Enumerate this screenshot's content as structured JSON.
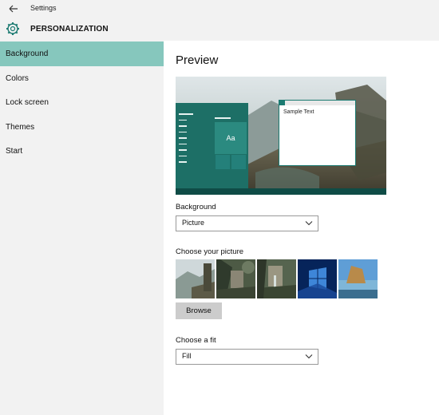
{
  "window": {
    "title": "Settings"
  },
  "header": {
    "title": "PERSONALIZATION"
  },
  "sidebar": {
    "items": [
      {
        "label": "Background",
        "active": true
      },
      {
        "label": "Colors",
        "active": false
      },
      {
        "label": "Lock screen",
        "active": false
      },
      {
        "label": "Themes",
        "active": false
      },
      {
        "label": "Start",
        "active": false
      }
    ]
  },
  "main": {
    "preview_heading": "Preview",
    "preview": {
      "tile_text": "Aa",
      "window_text": "Sample Text"
    },
    "background": {
      "label": "Background",
      "value": "Picture"
    },
    "picture": {
      "label": "Choose your picture",
      "thumbnails": [
        "landscape-ruins",
        "jungle-ruins",
        "jungle-waterfall",
        "windows-hero",
        "beach-rock"
      ],
      "browse_label": "Browse"
    },
    "fit": {
      "label": "Choose a fit",
      "value": "Fill"
    }
  },
  "colors": {
    "accent": "#1b7a71",
    "nav_active": "#86c7bd",
    "button": "#cccccc"
  }
}
